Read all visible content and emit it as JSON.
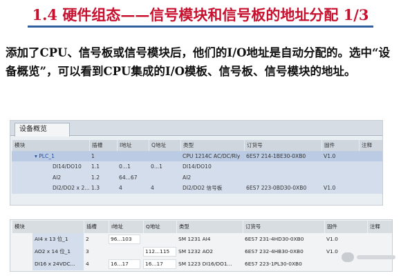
{
  "title": "1.4  硬件组态——信号模块和信号板的地址分配 1/3",
  "paragraph": "添加了CPU、信号板或信号模块后，他们的I/O地址是自动分配的。选中“设备概览”，可以看到CPU集成的I/O模板、信号板、信号模块的地址。",
  "panel1": {
    "tab": "设备概览",
    "headers": [
      "模块",
      "插槽",
      "I地址",
      "Q地址",
      "类型",
      "订货号",
      "固件",
      "注释"
    ],
    "rows": [
      [
        "▾ PLC_1",
        "1",
        "",
        "",
        "CPU 1214C AC/DC/Rly",
        "6ES7 214-1BE30-0XB0",
        "V1.0",
        ""
      ],
      [
        "DI14/DO10",
        "1.1",
        "0...1",
        "0...1",
        "DI14/DO10",
        "",
        "",
        ""
      ],
      [
        "AI2",
        "1.2",
        "64...67",
        "",
        "AI2",
        "",
        "",
        ""
      ],
      [
        "DI2/DO2 x 2...",
        "1.3",
        "4",
        "4",
        "DI2/DO2 信号板",
        "6ES7 223-0BD30-0XB0",
        "V1.0",
        ""
      ]
    ]
  },
  "panel2": {
    "headers": [
      "模块",
      "插槽",
      "I地址",
      "Q地址",
      "类型",
      "订货号",
      "固件",
      "注释"
    ],
    "rows": [
      [
        "AI4 x 13 位_1",
        "2",
        "96...103",
        "",
        "SM 1231 AI4",
        "6ES7 231-4HD30-0XB0",
        "V1.0",
        ""
      ],
      [
        "AO2 x 14 位_1",
        "3",
        "",
        "112...115",
        "SM 1232 AO2",
        "6ES7 232-4HB30-0XB0",
        "V1.0",
        ""
      ],
      [
        "DI16 x 24VDC...",
        "4",
        "16...17",
        "16...17",
        "SM 1223 DI16/DO1...",
        "6ES7 223-1PL30-0XB0",
        "",
        ""
      ]
    ]
  },
  "colors": {
    "title": "#c8102e",
    "rule": "#2f5f9e",
    "plc_row": "#bccbe4",
    "selected_rows": "#d3ddec"
  }
}
